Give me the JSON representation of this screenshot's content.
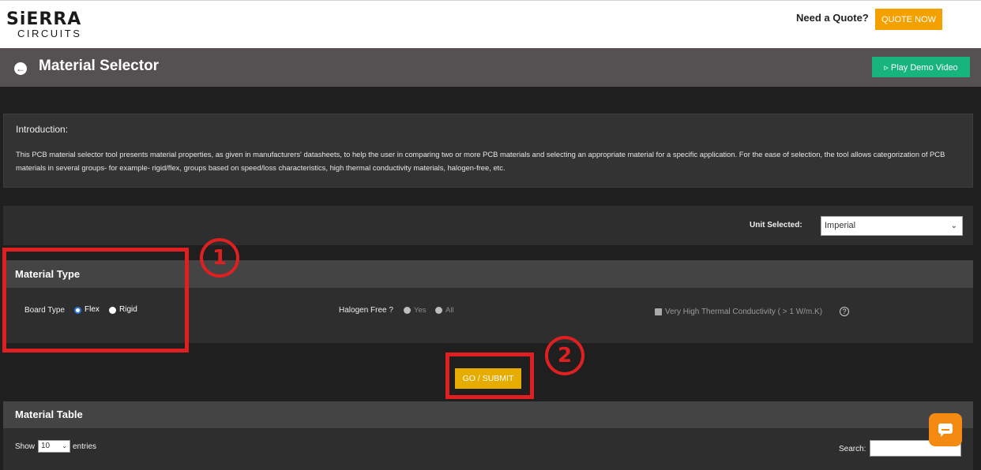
{
  "brand": {
    "logo_main": "SiERRA",
    "logo_sub": "CIRCUITS"
  },
  "topbar": {
    "quote_text": "Need a Quote?",
    "quote_button": "QUOTE NOW"
  },
  "header": {
    "title": "Material Selector",
    "back_icon": "arrow-left-icon",
    "demo_button": "▹  Play Demo Video"
  },
  "intro": {
    "heading": "Introduction:",
    "body": "This PCB material selector tool presents material properties, as given in manufacturers' datasheets, to help the user in comparing two or more PCB materials and selecting an appropriate material for a specific application. For the ease of selection, the tool allows categorization of PCB materials in several groups- for example- rigid/flex, groups based on speed/loss characteristics, high thermal conductivity materials, halogen-free, etc."
  },
  "units": {
    "label": "Unit Selected:",
    "selected": "Imperial"
  },
  "material_type": {
    "title": "Material Type",
    "board_type_label": "Board Type",
    "board_options": [
      {
        "label": "Flex",
        "checked": true
      },
      {
        "label": "Rigid",
        "checked": false
      }
    ],
    "halogen_label": "Halogen Free ?",
    "halogen_options": [
      {
        "label": "Yes",
        "disabled": true
      },
      {
        "label": "All",
        "disabled": true
      }
    ],
    "thermal_label": "Very High Thermal Conductivity ( > 1 W/m.K)",
    "help_icon": "?"
  },
  "submit_button": "GO / SUBMIT",
  "material_table": {
    "title": "Material Table",
    "show_label": "Show",
    "entries_value": "10",
    "entries_label": "entries",
    "search_label": "Search:"
  },
  "annotations": {
    "step1": "1",
    "step2": "2"
  },
  "colors": {
    "accent_orange": "#f4a100",
    "demo_green": "#17b47e",
    "submit_gold": "#e6ac00",
    "annotation_red": "#e02020",
    "chat_orange": "#f48a12"
  }
}
